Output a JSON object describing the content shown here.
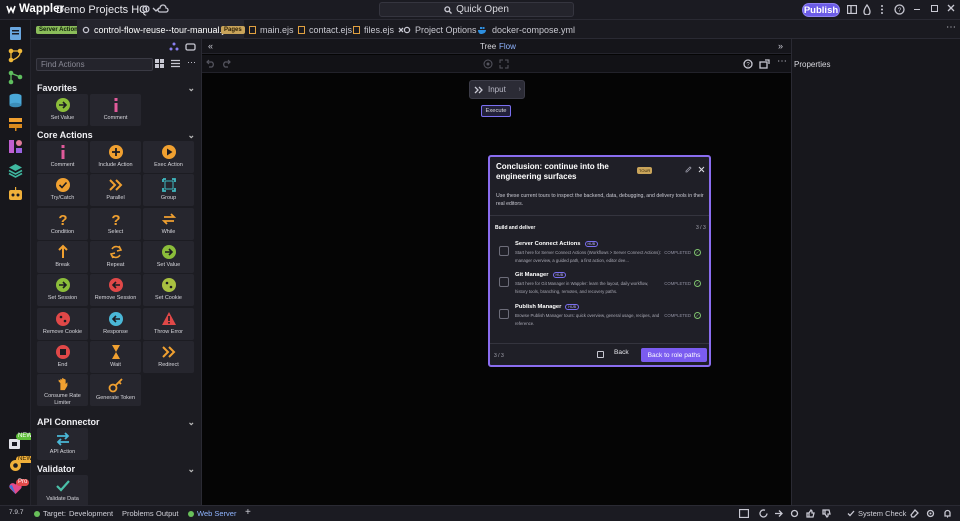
{
  "titlebar": {
    "app_name": "Wappler",
    "project": "Demo Projects HQ",
    "quick_open": "Quick Open",
    "publish": "Publish"
  },
  "activity": {
    "badges": [
      "NEW",
      "NEW",
      "Pro"
    ]
  },
  "tabs": [
    {
      "tag": "Server Actions",
      "label": "control-flow-reuse--tour-manual.json",
      "active": true
    },
    {
      "tag": "Pages",
      "label": "main.ejs"
    },
    {
      "label": "contact.ejs"
    },
    {
      "label": "files.ejs"
    },
    {
      "label": "Project Options"
    },
    {
      "label": "docker-compose.yml"
    }
  ],
  "canvas": {
    "view_tree": "Tree",
    "view_flow": "Flow",
    "input_node": "Input",
    "execute": "Execute"
  },
  "right_panel": {
    "title": "Properties"
  },
  "left_panel": {
    "search_placeholder": "Find Actions",
    "favorites_title": "Favorites",
    "favorites": [
      "Set Value",
      "Comment"
    ],
    "core_title": "Core Actions",
    "core": [
      "Comment",
      "Include Action",
      "Exec Action",
      "Try/Catch",
      "Parallel",
      "Group",
      "Condition",
      "Select",
      "While",
      "Break",
      "Repeat",
      "Set Value",
      "Set Session",
      "Remove Session",
      "Set Cookie",
      "Remove Cookie",
      "Response",
      "Throw Error",
      "End",
      "Wait",
      "Redirect",
      "Consume Rate Limiter",
      "Generate Token"
    ],
    "api_title": "API Connector",
    "api": [
      "API Action"
    ],
    "validator_title": "Validator",
    "validator": [
      "Validate Data"
    ]
  },
  "tour": {
    "title": "Conclusion: continue into the engineering surfaces",
    "tag": "TOUR",
    "description": "Use these current tours to inspect the backend, data, debugging, and delivery tools in their real editors.",
    "section": "Build and deliver",
    "section_count": "3 / 3",
    "items": [
      {
        "title": "Server Connect Actions",
        "badge": "HUB",
        "desc": "Start here for Server Connect Actions (Workflows > Server Connect Actions): manager overview, a guided path, a first action, editor dee...",
        "status": "COMPLETED"
      },
      {
        "title": "Git Manager",
        "badge": "HUB",
        "desc": "Start here for Git Manager in Wappler: learn the layout, daily workflow, history tools, branching, remotes, and recovery paths.",
        "status": "COMPLETED"
      },
      {
        "title": "Publish Manager",
        "badge": "HUB",
        "desc": "Browse Publish Manager tours: quick overview, general usage, recipes, and reference.",
        "status": "COMPLETED"
      }
    ],
    "footer_count": "3 / 3",
    "back": "Back",
    "back_role": "Back to role paths"
  },
  "statusbar": {
    "version": "7.9.7",
    "target_label": "Target:",
    "target_value": "Development",
    "problems": "Problems",
    "output": "Output",
    "web_server": "Web Server",
    "system_check": "System Check"
  }
}
